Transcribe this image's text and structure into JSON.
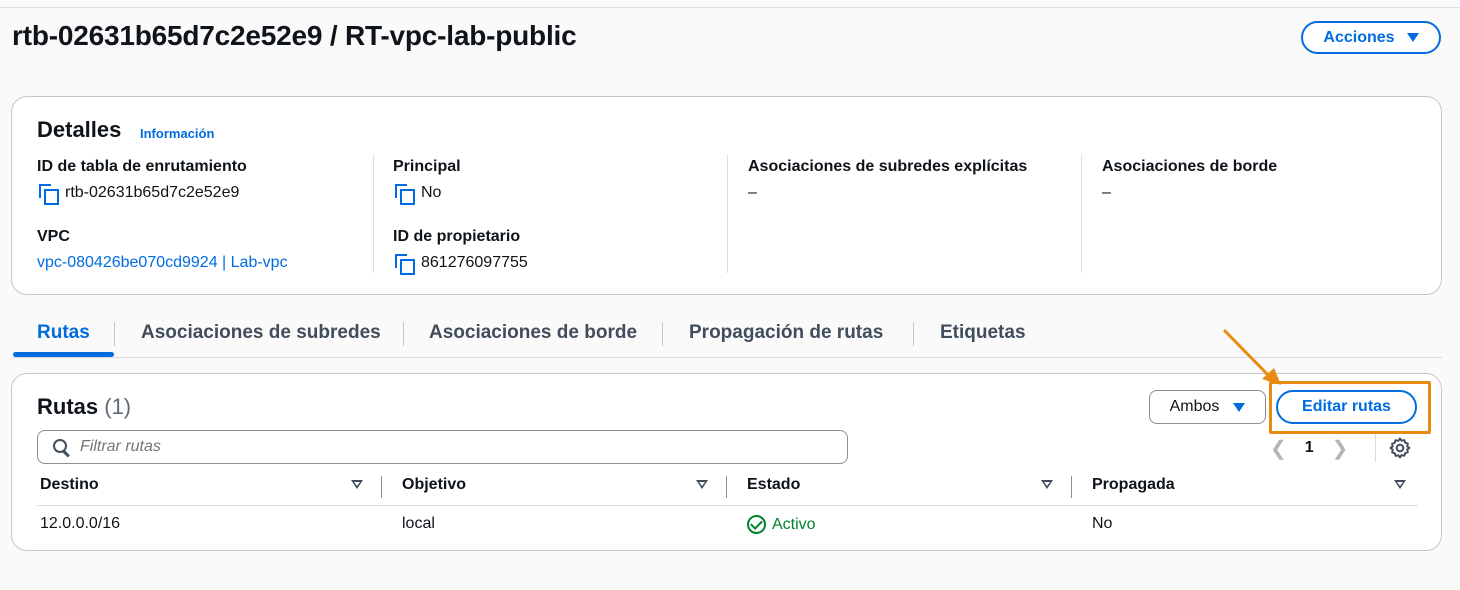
{
  "header": {
    "title": "rtb-02631b65d7c2e52e9 / RT-vpc-lab-public",
    "actions_label": "Acciones"
  },
  "details": {
    "title": "Detalles",
    "info_link": "Información",
    "fields": {
      "route_table_id_label": "ID de tabla de enrutamiento",
      "route_table_id_value": "rtb-02631b65d7c2e52e9",
      "vpc_label": "VPC",
      "vpc_value": "vpc-080426be070cd9924 | Lab-vpc",
      "main_label": "Principal",
      "main_value": "No",
      "owner_label": "ID de propietario",
      "owner_value": "861276097755",
      "subnet_assoc_label": "Asociaciones de subredes explícitas",
      "subnet_assoc_value": "–",
      "edge_assoc_label": "Asociaciones de borde",
      "edge_assoc_value": "–"
    }
  },
  "tabs": [
    {
      "label": "Rutas",
      "active": true
    },
    {
      "label": "Asociaciones de subredes",
      "active": false
    },
    {
      "label": "Asociaciones de borde",
      "active": false
    },
    {
      "label": "Propagación de rutas",
      "active": false
    },
    {
      "label": "Etiquetas",
      "active": false
    }
  ],
  "routes": {
    "title": "Rutas",
    "count": "(1)",
    "filter_select": "Ambos",
    "edit_label": "Editar rutas",
    "search_placeholder": "Filtrar rutas",
    "page": "1",
    "columns": [
      "Destino",
      "Objetivo",
      "Estado",
      "Propagada"
    ],
    "rows": [
      {
        "destination": "12.0.0.0/16",
        "target": "local",
        "status": "Activo",
        "propagated": "No"
      }
    ]
  },
  "colors": {
    "accent": "#006ce0",
    "success": "#00802f",
    "highlight": "#e78b12"
  }
}
